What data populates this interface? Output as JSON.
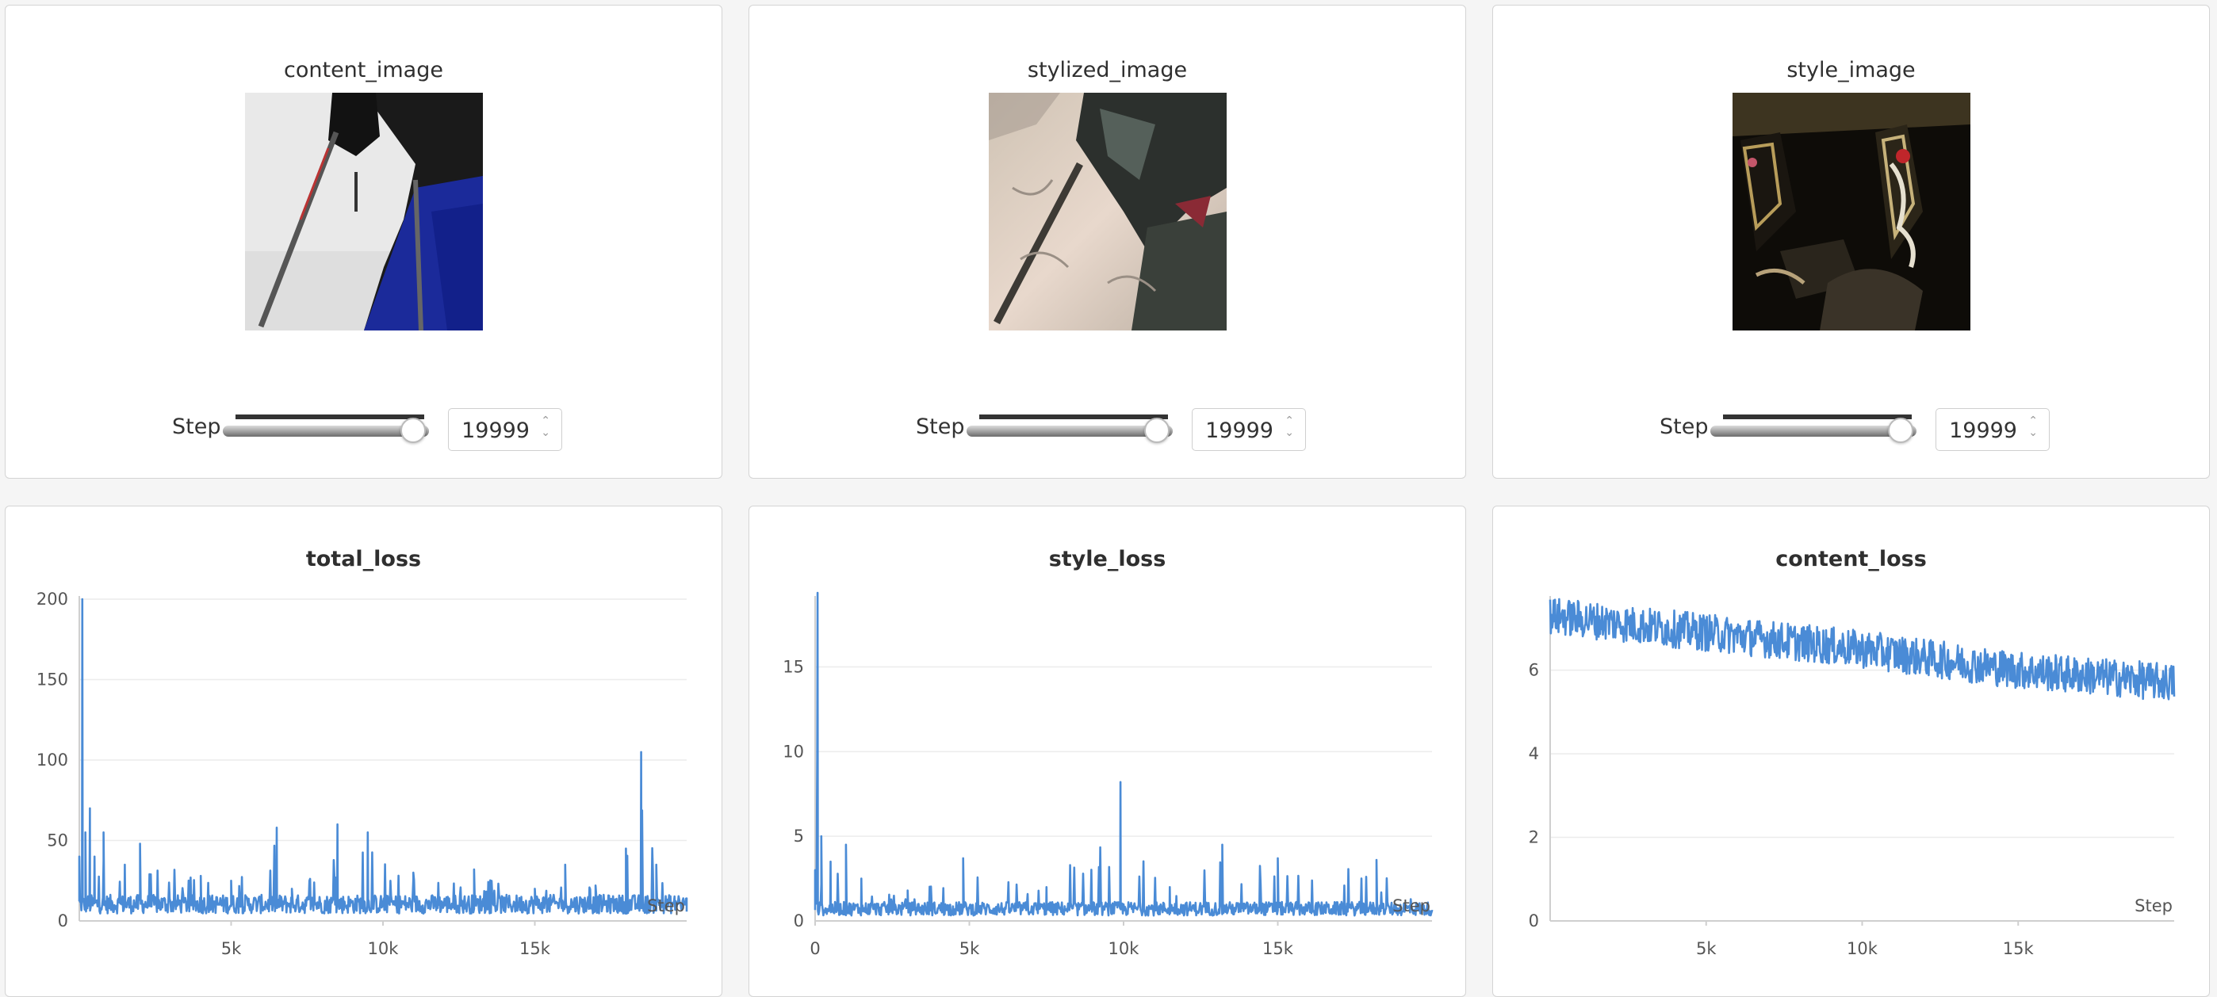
{
  "image_panels": [
    {
      "title": "content_image",
      "step_label": "Step",
      "step_value": "19999",
      "slider_fraction": 1.0,
      "thumbnail": "content-photo"
    },
    {
      "title": "stylized_image",
      "step_label": "Step",
      "step_value": "19999",
      "slider_fraction": 1.0,
      "thumbnail": "stylized-photo"
    },
    {
      "title": "style_image",
      "step_label": "Step",
      "step_value": "19999",
      "slider_fraction": 1.0,
      "thumbnail": "style-painting"
    }
  ],
  "colors": {
    "series": "#4a8bd6",
    "panel_border": "#d4d4d4",
    "background": "#f5f5f5"
  },
  "chart_data": [
    {
      "type": "line",
      "title": "total_loss",
      "xlabel": "Step",
      "ylabel": "",
      "xlim": [
        0,
        20000
      ],
      "ylim": [
        0,
        200
      ],
      "xticks": [
        {
          "v": 5000,
          "label": "5k"
        },
        {
          "v": 10000,
          "label": "10k"
        },
        {
          "v": 15000,
          "label": "15k"
        }
      ],
      "yticks": [
        {
          "v": 0,
          "label": "0"
        },
        {
          "v": 50,
          "label": "50"
        },
        {
          "v": 100,
          "label": "100"
        },
        {
          "v": 150,
          "label": "150"
        },
        {
          "v": 200,
          "label": "200"
        }
      ],
      "grid": true,
      "series": [
        {
          "baseline": 13,
          "points": [
            [
              0,
              40
            ],
            [
              100,
              200
            ],
            [
              200,
              55
            ],
            [
              350,
              70
            ],
            [
              500,
              40
            ],
            [
              800,
              55
            ],
            [
              1500,
              35
            ],
            [
              2000,
              48
            ],
            [
              4000,
              28
            ],
            [
              5000,
              25
            ],
            [
              6500,
              58
            ],
            [
              7000,
              20
            ],
            [
              8500,
              60
            ],
            [
              9500,
              55
            ],
            [
              11000,
              30
            ],
            [
              13000,
              32
            ],
            [
              15000,
              20
            ],
            [
              16000,
              35
            ],
            [
              17000,
              22
            ],
            [
              18000,
              45
            ],
            [
              18500,
              105
            ],
            [
              19000,
              35
            ],
            [
              19999,
              14
            ]
          ]
        }
      ]
    },
    {
      "type": "line",
      "title": "style_loss",
      "xlabel": "Step",
      "ylabel": "",
      "xlim": [
        0,
        20000
      ],
      "ylim": [
        0,
        19
      ],
      "xticks": [
        {
          "v": 0,
          "label": "0"
        },
        {
          "v": 5000,
          "label": "5k"
        },
        {
          "v": 10000,
          "label": "10k"
        },
        {
          "v": 15000,
          "label": "15k"
        }
      ],
      "yticks": [
        {
          "v": 0,
          "label": "0"
        },
        {
          "v": 5,
          "label": "5"
        },
        {
          "v": 10,
          "label": "10"
        },
        {
          "v": 15,
          "label": "15"
        }
      ],
      "grid": true,
      "series": [
        {
          "baseline": 0.9,
          "points": [
            [
              0,
              3
            ],
            [
              80,
              19.5
            ],
            [
              200,
              5
            ],
            [
              500,
              3.5
            ],
            [
              1000,
              4.5
            ],
            [
              1500,
              2.5
            ],
            [
              3000,
              1.8
            ],
            [
              4800,
              3.7
            ],
            [
              7500,
              2
            ],
            [
              9900,
              8.2
            ],
            [
              11500,
              2
            ],
            [
              13200,
              4.5
            ],
            [
              15000,
              3.7
            ],
            [
              18200,
              3.6
            ],
            [
              19999,
              0.6
            ]
          ]
        }
      ]
    },
    {
      "type": "line",
      "title": "content_loss",
      "xlabel": "Step",
      "ylabel": "",
      "xlim": [
        0,
        20000
      ],
      "ylim": [
        0,
        7.7
      ],
      "xticks": [
        {
          "v": 5000,
          "label": "5k"
        },
        {
          "v": 10000,
          "label": "10k"
        },
        {
          "v": 15000,
          "label": "15k"
        }
      ],
      "yticks": [
        {
          "v": 0,
          "label": "0"
        },
        {
          "v": 2,
          "label": "2"
        },
        {
          "v": 4,
          "label": "4"
        },
        {
          "v": 6,
          "label": "6"
        }
      ],
      "grid": true,
      "series": [
        {
          "trend": [
            [
              0,
              7.3
            ],
            [
              5000,
              6.9
            ],
            [
              10000,
              6.5
            ],
            [
              15000,
              6.0
            ],
            [
              19999,
              5.7
            ]
          ],
          "noise": 0.45
        }
      ]
    }
  ]
}
